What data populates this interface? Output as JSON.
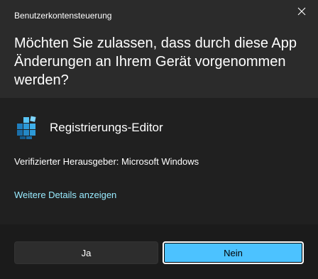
{
  "window": {
    "title": "Benutzerkontensteuerung"
  },
  "header": {
    "question": "Möchten Sie zulassen, dass durch diese App Änderungen an Ihrem Gerät vorgenommen werden?"
  },
  "app": {
    "name": "Registrierungs-Editor",
    "icon": "registry-editor-icon",
    "publisher": "Verifizierter Herausgeber: Microsoft Windows"
  },
  "details_link": "Weitere Details anzeigen",
  "buttons": {
    "yes_label": "Ja",
    "no_label": "Nein"
  },
  "colors": {
    "accent": "#4cc2ff",
    "link": "#99ebff",
    "header_bg": "#2b2b2b",
    "body_bg": "#202020",
    "footer_bg": "#1b1b1b"
  }
}
